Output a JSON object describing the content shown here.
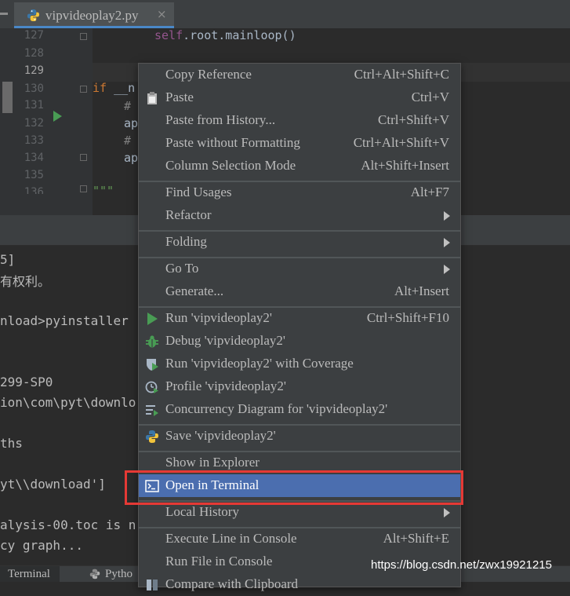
{
  "editor": {
    "tab_title": "vipvideoplay2.py",
    "tab_close": "×",
    "line_numbers": [
      "127",
      "128",
      "129",
      "130",
      "131",
      "132",
      "133",
      "134",
      "135",
      "136"
    ],
    "code": {
      "l127_self": "self",
      "l127_rest": ".root.mainloop()",
      "l130_kw": "if",
      "l130_rest": " __n",
      "l131": "#",
      "l132": "ap",
      "l133": "#",
      "l134": "ap",
      "l136": "\"\"\""
    }
  },
  "terminal": {
    "lines": [
      "5]",
      "有权利。",
      "nload>pyinstaller",
      "299-SP0",
      "ion\\com\\pyt\\downlo",
      "ths",
      "yt\\\\download']",
      "alysis-00.toc is n",
      "cy graph..."
    ]
  },
  "bottom_tabs": {
    "terminal": "Terminal",
    "python": "Pytho"
  },
  "context_menu": {
    "items": [
      {
        "label": "Copy Reference",
        "shortcut": "Ctrl+Alt+Shift+C"
      },
      {
        "label": "Paste",
        "shortcut": "Ctrl+V",
        "icon": "clipboard-icon"
      },
      {
        "label": "Paste from History...",
        "shortcut": "Ctrl+Shift+V"
      },
      {
        "label": "Paste without Formatting",
        "shortcut": "Ctrl+Alt+Shift+V"
      },
      {
        "label": "Column Selection Mode",
        "shortcut": "Alt+Shift+Insert"
      },
      {
        "label": "Find Usages",
        "shortcut": "Alt+F7"
      },
      {
        "label": "Refactor",
        "submenu": true
      },
      {
        "label": "Folding",
        "submenu": true
      },
      {
        "label": "Go To",
        "submenu": true
      },
      {
        "label": "Generate...",
        "shortcut": "Alt+Insert"
      },
      {
        "label": "Run 'vipvideoplay2'",
        "shortcut": "Ctrl+Shift+F10",
        "icon": "run-icon"
      },
      {
        "label": "Debug 'vipvideoplay2'",
        "icon": "debug-icon"
      },
      {
        "label": "Run 'vipvideoplay2' with Coverage",
        "icon": "coverage-icon"
      },
      {
        "label": "Profile 'vipvideoplay2'",
        "icon": "profile-icon"
      },
      {
        "label": "Concurrency Diagram for 'vipvideoplay2'",
        "icon": "concurrency-icon"
      },
      {
        "label": "Save 'vipvideoplay2'",
        "icon": "python-icon"
      },
      {
        "label": "Show in Explorer"
      },
      {
        "label": "Open in Terminal",
        "icon": "terminal-icon",
        "selected": true
      },
      {
        "label": "Local History",
        "submenu": true
      },
      {
        "label": "Execute Line in Console",
        "shortcut": "Alt+Shift+E"
      },
      {
        "label": "Run File in Console"
      },
      {
        "label": "Compare with Clipboard"
      }
    ]
  },
  "watermark": "https://blog.csdn.net/zwx19921215",
  "colors": {
    "selection": "#4b6eaf",
    "highlight_box": "#e53935",
    "run_green": "#499c54"
  }
}
